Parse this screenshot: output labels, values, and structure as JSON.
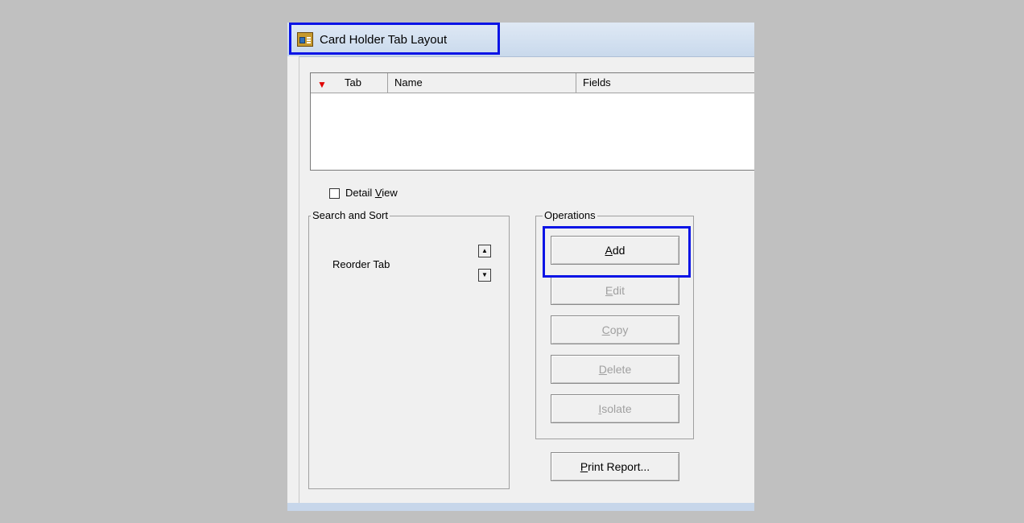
{
  "window": {
    "title": "Card Holder Tab Layout",
    "title_icon": "card-holder-app-icon"
  },
  "list": {
    "sort_indicator_color": "#e00000",
    "columns": [
      "Tab",
      "Name",
      "Fields"
    ],
    "rows": []
  },
  "detail_view": {
    "label_before": "Detail ",
    "label_underlined": "V",
    "label_after": "iew",
    "checked": false
  },
  "search_sort": {
    "legend": "Search and Sort",
    "reorder_label": "Reorder Tab",
    "up_icon": "arrow-up-icon",
    "down_icon": "arrow-down-icon"
  },
  "operations": {
    "legend": "Operations",
    "add": {
      "mnemonic": "A",
      "rest": "dd",
      "enabled": true
    },
    "edit": {
      "mnemonic": "E",
      "rest": "dit",
      "enabled": false
    },
    "copy": {
      "mnemonic": "C",
      "rest": "opy",
      "enabled": false
    },
    "delete": {
      "mnemonic": "D",
      "rest": "elete",
      "enabled": false
    },
    "isolate": {
      "mnemonic": "I",
      "rest": "solate",
      "enabled": false
    }
  },
  "print": {
    "mnemonic": "P",
    "rest": "rint Report...",
    "enabled": true
  },
  "highlight_color": "#0a14e6"
}
